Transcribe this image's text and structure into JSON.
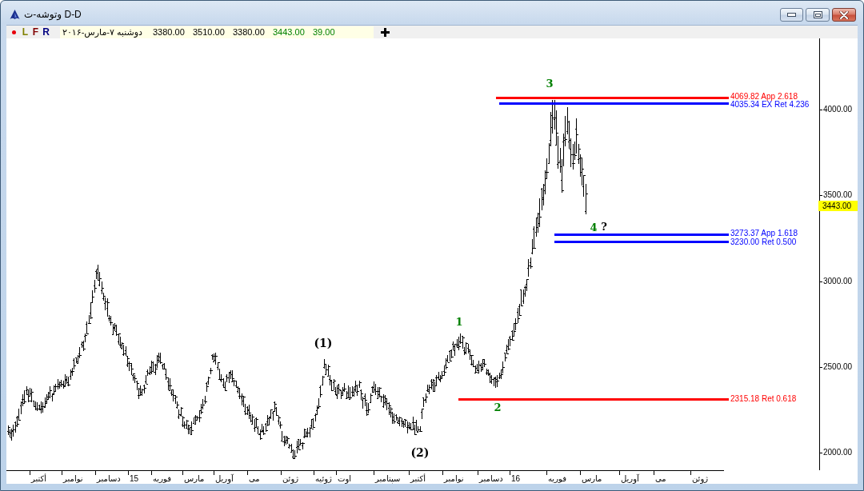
{
  "window": {
    "title": "وتوشه-ت D-D"
  },
  "toolbar": {
    "buttons": [
      {
        "label": "R",
        "color": "#000080"
      },
      {
        "label": "F",
        "color": "#800000"
      },
      {
        "label": "L",
        "color": "#808000"
      }
    ],
    "quote": {
      "values": [
        {
          "text": "39.00",
          "color": "#008000"
        },
        {
          "text": "3443.00",
          "color": "#008000"
        },
        {
          "text": "3380.00",
          "color": "#000000"
        },
        {
          "text": "3510.00",
          "color": "#000000"
        },
        {
          "text": "3380.00",
          "color": "#000000"
        }
      ],
      "date": "دوشنبه ۷-مارس-۲۰۱۶"
    }
  },
  "chart": {
    "price_ticks": [
      "4000.00",
      "3500.00",
      "3000.00",
      "2500.00",
      "2000.00"
    ],
    "last_price": "3443.00",
    "fib_levels": [
      {
        "label": "4069.82 App 2.618",
        "color": "#ff0000"
      },
      {
        "label": "4035.34 EX Ret 4.236",
        "color": "#0000ff"
      },
      {
        "label": "3273.37 App 1.618",
        "color": "#0000ff"
      },
      {
        "label": "3230.00 Ret 0.500",
        "color": "#0000ff"
      },
      {
        "label": "2315.18 Ret 0.618",
        "color": "#ff0000"
      }
    ],
    "wave_labels": [
      {
        "text": "(1)",
        "color": "#000000"
      },
      {
        "text": "(2)",
        "color": "#000000"
      },
      {
        "text": "1",
        "color": "#008000"
      },
      {
        "text": "2",
        "color": "#008000"
      },
      {
        "text": "3",
        "color": "#008000"
      },
      {
        "text": "4",
        "color": "#008000"
      },
      {
        "text": "?",
        "color": "#000000"
      }
    ],
    "time_ticks": [
      "ژوئن",
      "می",
      "آوریل",
      "مارس",
      "فوریه",
      "16",
      "دسامبر",
      "نوامبر",
      "أکتبر",
      "سپتامبر",
      "اوت",
      "ژوئیه",
      "ژوئن",
      "می",
      "آوریل",
      "مارس",
      "فوریه",
      "15",
      "دسامبر",
      "نوامبر",
      "أکتبر"
    ]
  }
}
